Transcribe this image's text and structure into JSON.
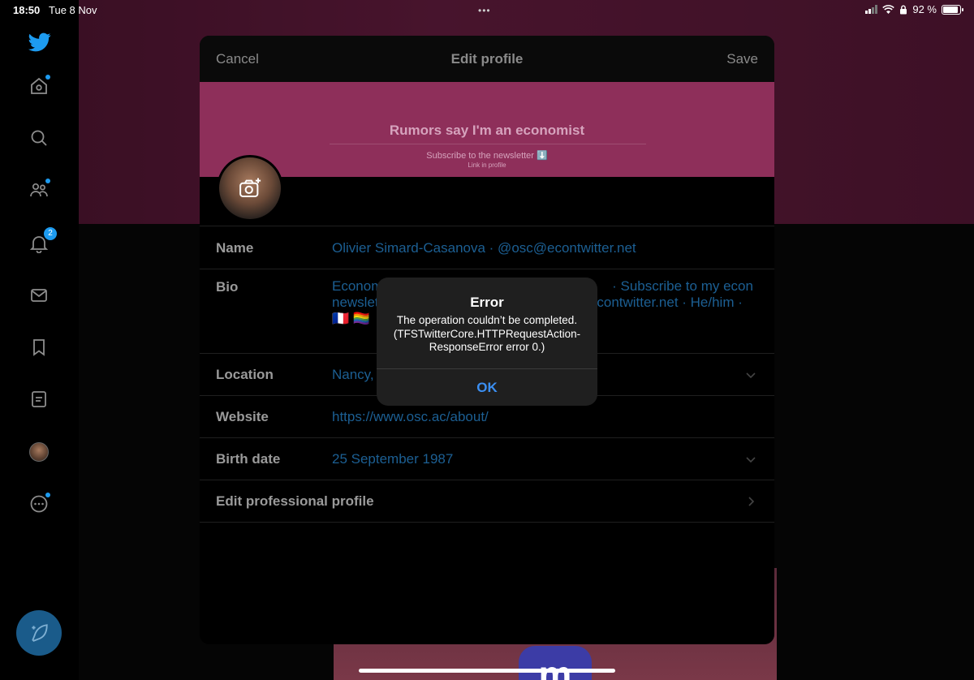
{
  "status_bar": {
    "time": "18:50",
    "date": "Tue 8 Nov",
    "multitask": "•••",
    "battery": "92 %",
    "battery_level": 0.92
  },
  "sidebar": {
    "items": [
      {
        "icon": "twitter-bird-icon"
      },
      {
        "icon": "home-icon",
        "dot": true
      },
      {
        "icon": "search-icon"
      },
      {
        "icon": "communities-icon",
        "dot": true
      },
      {
        "icon": "notifications-icon",
        "badge": "2"
      },
      {
        "icon": "messages-icon"
      },
      {
        "icon": "bookmarks-icon"
      },
      {
        "icon": "lists-icon"
      },
      {
        "icon": "profile-avatar-icon"
      },
      {
        "icon": "more-icon",
        "dot": true
      }
    ],
    "compose_icon": "compose-feather-icon"
  },
  "sheet": {
    "cancel_label": "Cancel",
    "title": "Edit profile",
    "save_label": "Save"
  },
  "banner": {
    "headline": "Rumors say I'm an economist",
    "subtitle": "Subscribe to the newsletter ⬇️",
    "subtitle2": "Link in profile"
  },
  "fields": {
    "name": {
      "label": "Name",
      "value": "Olivier Simard-Casanova · @osc@econtwitter.net"
    },
    "bio": {
      "label": "Bio",
      "line1_start": "Econom",
      "line1_end": "· Subscribe to my econ",
      "line2_start": "newslet",
      "line2_end": "contwitter.net · He/him ·",
      "line3": "🇫🇷 🏳️‍🌈"
    },
    "location": {
      "label": "Location",
      "value": "Nancy,"
    },
    "website": {
      "label": "Website",
      "value": "https://www.osc.ac/about/"
    },
    "birth_date": {
      "label": "Birth date",
      "value": "25 September 1987"
    },
    "professional": {
      "label": "Edit professional profile"
    }
  },
  "alert": {
    "title": "Error",
    "message": "The operation couldn’t be completed. (TFSTwitterCore.HTTPRequestAction-ResponseError error 0.)",
    "ok_label": "OK"
  },
  "colors": {
    "accent": "#1d9bf0",
    "banner": "#8e2f5a",
    "link_dimmed": "#1c5f93",
    "alert_button": "#3b8ff2"
  }
}
